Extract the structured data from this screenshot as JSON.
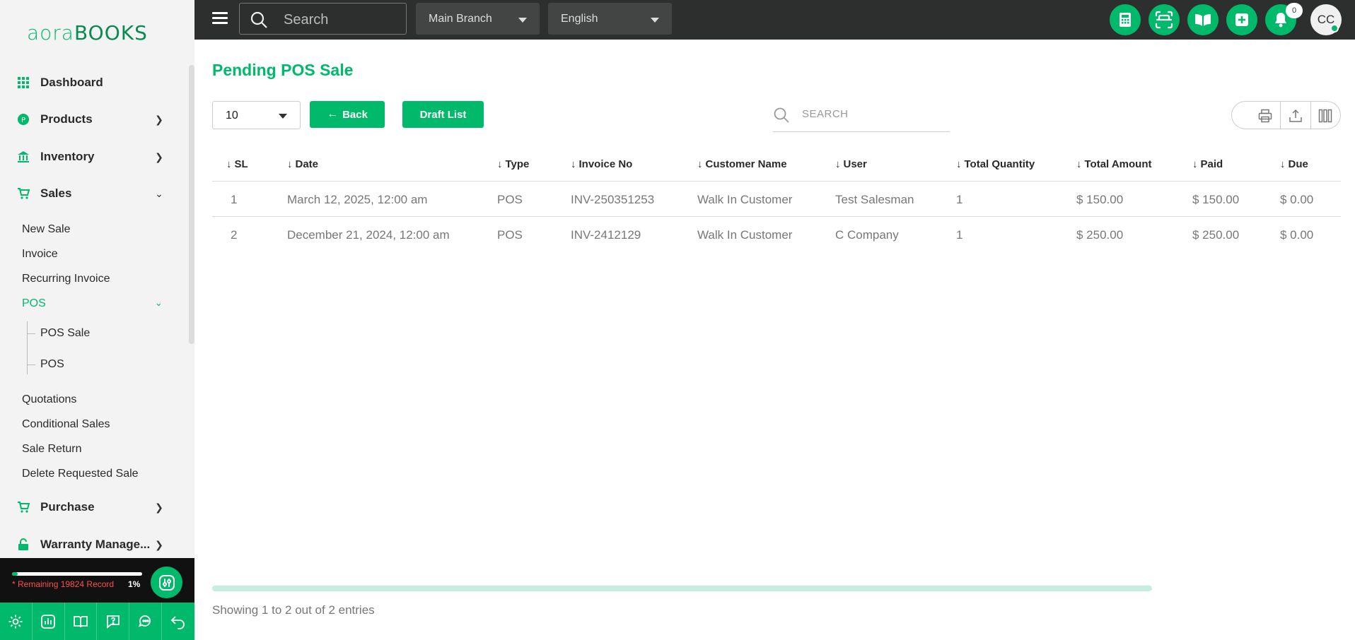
{
  "app": {
    "logo_part1": "aora",
    "logo_part2": "BOOKS"
  },
  "sidebar": {
    "items": [
      {
        "label": "Dashboard"
      },
      {
        "label": "Products"
      },
      {
        "label": "Inventory"
      },
      {
        "label": "Sales"
      },
      {
        "label": "Purchase"
      },
      {
        "label": "Warranty Manage..."
      }
    ],
    "sales_sub": [
      "New Sale",
      "Invoice",
      "Recurring Invoice",
      "POS",
      "Quotations",
      "Conditional Sales",
      "Sale Return",
      "Delete Requested Sale"
    ],
    "pos_sub": [
      "POS Sale",
      "POS"
    ],
    "remaining_text": "* Remaining 19824 Record",
    "percent_text": "1%",
    "usage_fraction": 0.01
  },
  "topbar": {
    "search_placeholder": "Search",
    "branch": "Main Branch",
    "language": "English",
    "notification_count": "0",
    "avatar_initials": "CC"
  },
  "main": {
    "title": "Pending POS Sale",
    "per_page": "10",
    "back_label": "Back",
    "draft_label": "Draft List",
    "table_search_placeholder": "SEARCH",
    "columns": [
      "SL",
      "Date",
      "Type",
      "Invoice No",
      "Customer Name",
      "User",
      "Total Quantity",
      "Total Amount",
      "Paid",
      "Due"
    ],
    "rows": [
      [
        "1",
        "March 12, 2025, 12:00 am",
        "POS",
        "INV-250351253",
        "Walk In Customer",
        "Test Salesman",
        "1",
        "$ 150.00",
        "$ 150.00",
        "$ 0.00"
      ],
      [
        "2",
        "December 21, 2024, 12:00 am",
        "POS",
        "INV-2412129",
        "Walk In Customer",
        "C Company",
        "1",
        "$ 250.00",
        "$ 250.00",
        "$ 0.00"
      ]
    ],
    "footer": "Showing 1 to 2 out of 2 entries"
  },
  "colors": {
    "accent": "#00b96b",
    "topbar": "#2d2f2e",
    "sidebar": "#f3f3f3"
  }
}
